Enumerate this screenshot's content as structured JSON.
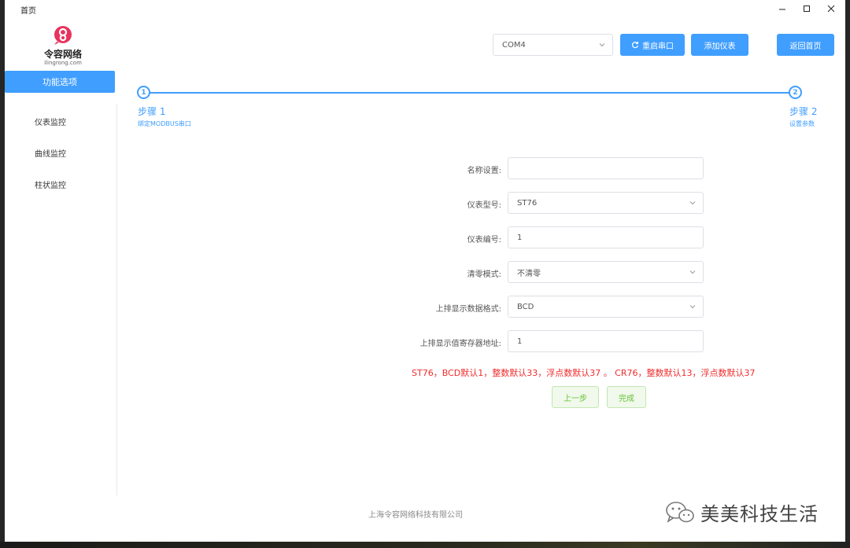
{
  "window": {
    "title": "首页"
  },
  "logo": {
    "brand": "令容网络",
    "sub": "ilingrong.com"
  },
  "sidebar": {
    "active": "功能选项",
    "items": [
      {
        "label": "仪表监控"
      },
      {
        "label": "曲线监控"
      },
      {
        "label": "柱状监控"
      }
    ]
  },
  "toolbar": {
    "port_value": "COM4",
    "restart_label": "重启串口",
    "add_label": "添加仪表",
    "home_label": "返回首页"
  },
  "steps": [
    {
      "number": "1",
      "title": "步骤 1",
      "desc": "绑定MODBUS串口"
    },
    {
      "number": "2",
      "title": "步骤 2",
      "desc": "设置参数"
    }
  ],
  "form": {
    "name_label": "名称设置:",
    "name_value": "",
    "model_label": "仪表型号:",
    "model_value": "ST76",
    "number_label": "仪表编号:",
    "number_value": "1",
    "clear_label": "清零模式:",
    "clear_value": "不清零",
    "format_label": "上排显示数据格式:",
    "format_value": "BCD",
    "addr_label": "上排显示值寄存器地址:",
    "addr_value": "1",
    "hint": "ST76，BCD默认1，整数默认33，浮点数默认37 。 CR76，整数默认13，浮点数默认37",
    "prev_label": "上一步",
    "finish_label": "完成"
  },
  "footer": {
    "company": "上海令容网络科技有限公司"
  },
  "watermark": {
    "text": "美美科技生活"
  },
  "colors": {
    "primary": "#409eff",
    "success": "#67c23a",
    "danger": "#f02b2b",
    "brand": "#e8335d"
  }
}
